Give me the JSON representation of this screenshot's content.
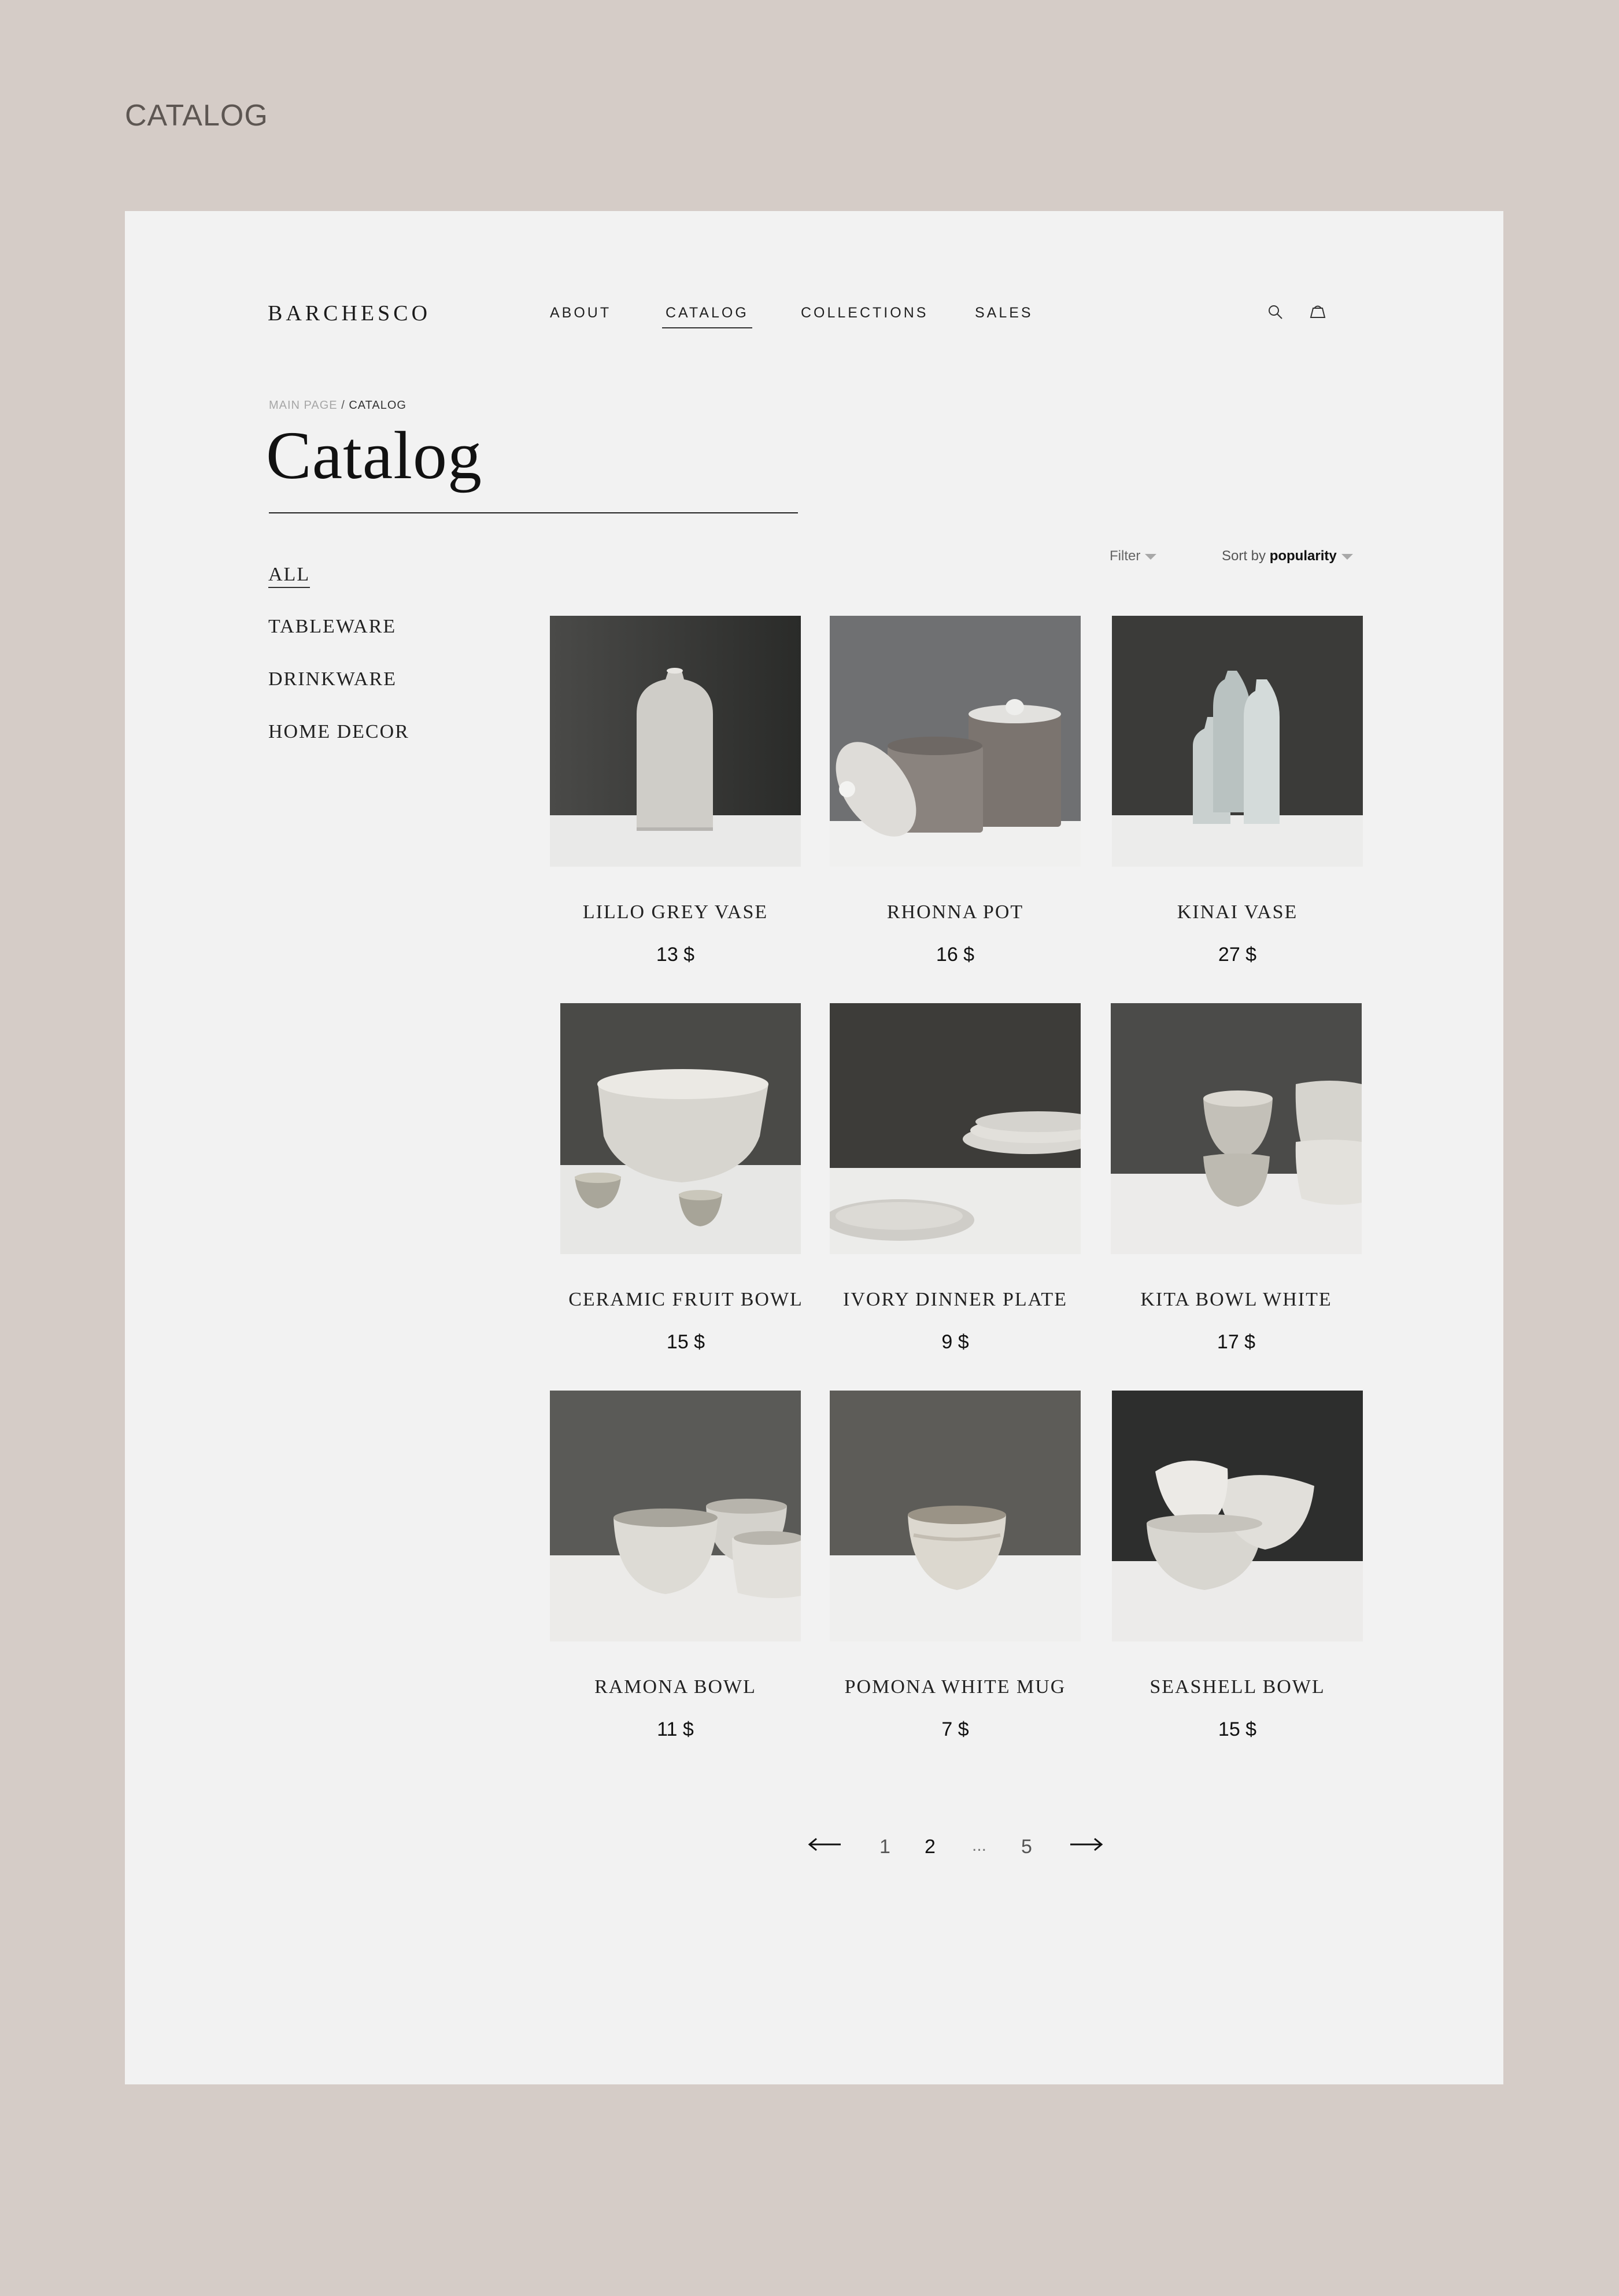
{
  "outer_title": "CATALOG",
  "header": {
    "logo": "BARCHESCO",
    "nav": [
      {
        "label": "ABOUT"
      },
      {
        "label": "CATALOG",
        "active": true
      },
      {
        "label": "COLLECTIONS"
      },
      {
        "label": "SALES"
      }
    ],
    "icons": [
      "search-icon",
      "cart-icon"
    ]
  },
  "breadcrumb": {
    "parent": "MAIN PAGE",
    "separator": "/",
    "current": "CATALOG"
  },
  "page_title": "Catalog",
  "categories": [
    {
      "label": "ALL",
      "active": true
    },
    {
      "label": "TABLEWARE"
    },
    {
      "label": "DRINKWARE"
    },
    {
      "label": "HOME DECOR"
    }
  ],
  "toolbar": {
    "filter_label": "Filter",
    "sort_prefix": "Sort by",
    "sort_value": "popularity"
  },
  "products": [
    {
      "name": "LILLO GREY VASE",
      "price": "13 $"
    },
    {
      "name": "RHONNA POT",
      "price": "16 $"
    },
    {
      "name": "KINAI VASE",
      "price": "27 $"
    },
    {
      "name": "CERAMIC FRUIT BOWL",
      "price": "15 $"
    },
    {
      "name": "IVORY DINNER PLATE",
      "price": "9 $"
    },
    {
      "name": "KITA BOWL WHITE",
      "price": "17 $"
    },
    {
      "name": "RAMONA BOWL",
      "price": "11 $"
    },
    {
      "name": "POMONA WHITE MUG",
      "price": "7 $"
    },
    {
      "name": "SEASHELL BOWL",
      "price": "15 $"
    }
  ],
  "pagination": {
    "pages": [
      "1",
      "2",
      "...",
      "5"
    ],
    "current": "2"
  },
  "colors": {
    "background": "#d5ccc7",
    "panel": "#f2f2f2",
    "text": "#1b1b1b"
  }
}
